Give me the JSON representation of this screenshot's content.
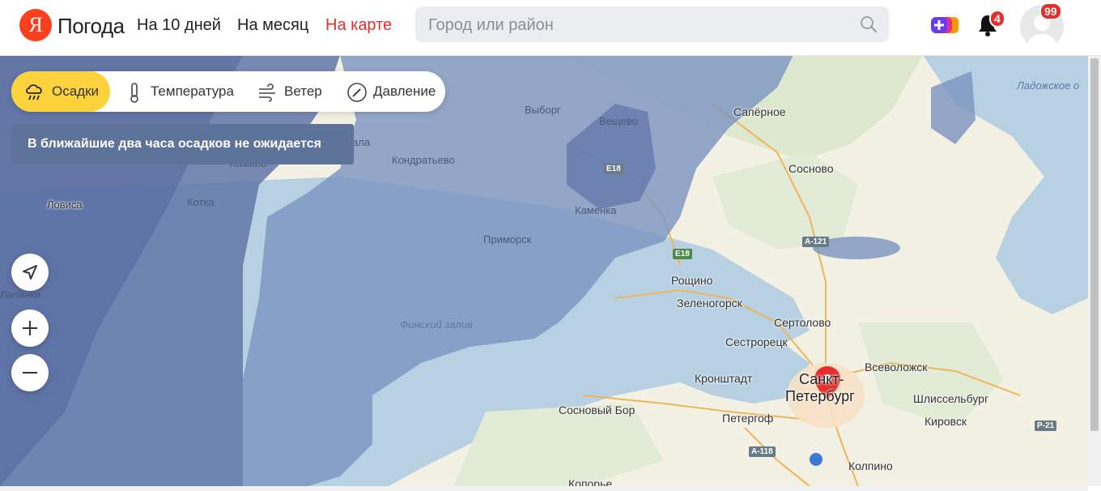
{
  "header": {
    "logo_letter": "Я",
    "logo_text": "Погода",
    "nav": [
      "На 10 дней",
      "На месяц",
      "На карте"
    ],
    "search_placeholder": "Город или район",
    "notifications_count": "4",
    "avatar_badge": "99"
  },
  "layers": {
    "items": [
      "Осадки",
      "Температура",
      "Ветер",
      "Давление"
    ],
    "active": "Осадки"
  },
  "notice": "В ближайшие два часа осадков не ожидается",
  "map": {
    "labels": {
      "vyborg": "Выборг",
      "veshchevo": "Вещево",
      "kondratyevo": "Кондратьево",
      "kamenka": "Каменка",
      "primorsk": "Приморск",
      "saperoe": "Сапёрное",
      "sosnovo": "Сосново",
      "kotka": "Котка",
      "hamina": "Хамина",
      "lovisa": "Ловиса",
      "lappinki": "Лапинки",
      "roshchino": "Рощино",
      "zelenogorsk": "Зеленогорск",
      "sertolovo": "Сертолово",
      "sestroretsk": "Сестрорецк",
      "kronshtadt": "Кронштадт",
      "spb_1": "Санкт-",
      "spb_2": "Петербург",
      "vsevolozhsk": "Всеволожск",
      "shlisselburg": "Шлиссельбург",
      "kirovsk": "Кировск",
      "sosnovy_bor": "Сосновый Бор",
      "peterhof": "Петергоф",
      "kolpino": "Колпино",
      "koporye": "Копорье",
      "gulf": "Финский залив",
      "ladoga": "Ладожское о",
      "ala": "ала"
    },
    "roads": [
      "E18",
      "E18",
      "A-121",
      "A-118",
      "P-21"
    ]
  },
  "colors": {
    "accent_yellow": "#fcd33d",
    "brand_red": "#fc3f1d",
    "active_nav": "#e52e2e",
    "notice_bg": "#5e739a"
  }
}
